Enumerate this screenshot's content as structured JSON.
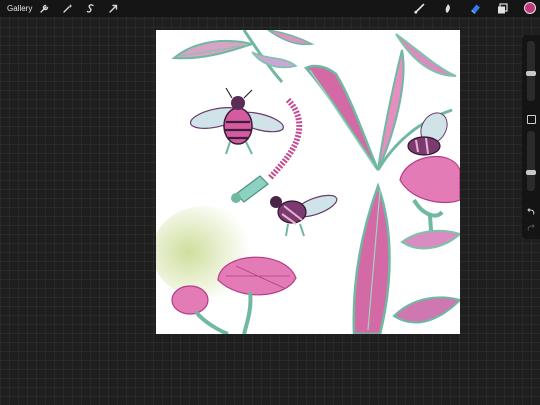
{
  "topbar": {
    "gallery_label": "Gallery",
    "left_tools": [
      "wrench-icon",
      "magic-wand-icon",
      "selection-icon",
      "transform-icon"
    ],
    "right_tools": [
      "brush-icon",
      "smudge-icon",
      "eraser-icon",
      "layers-icon"
    ],
    "active_color": "#c0397a"
  },
  "sidebar": {
    "brush_size_level": 0.45,
    "opacity_level": 0.3
  },
  "colors": {
    "canvas_background": "#ffffff",
    "accent_blue": "#2e7de9",
    "pink": "#d64a9a",
    "leaf_green": "#6fb8a1",
    "spray_green": "#c4d68a"
  }
}
